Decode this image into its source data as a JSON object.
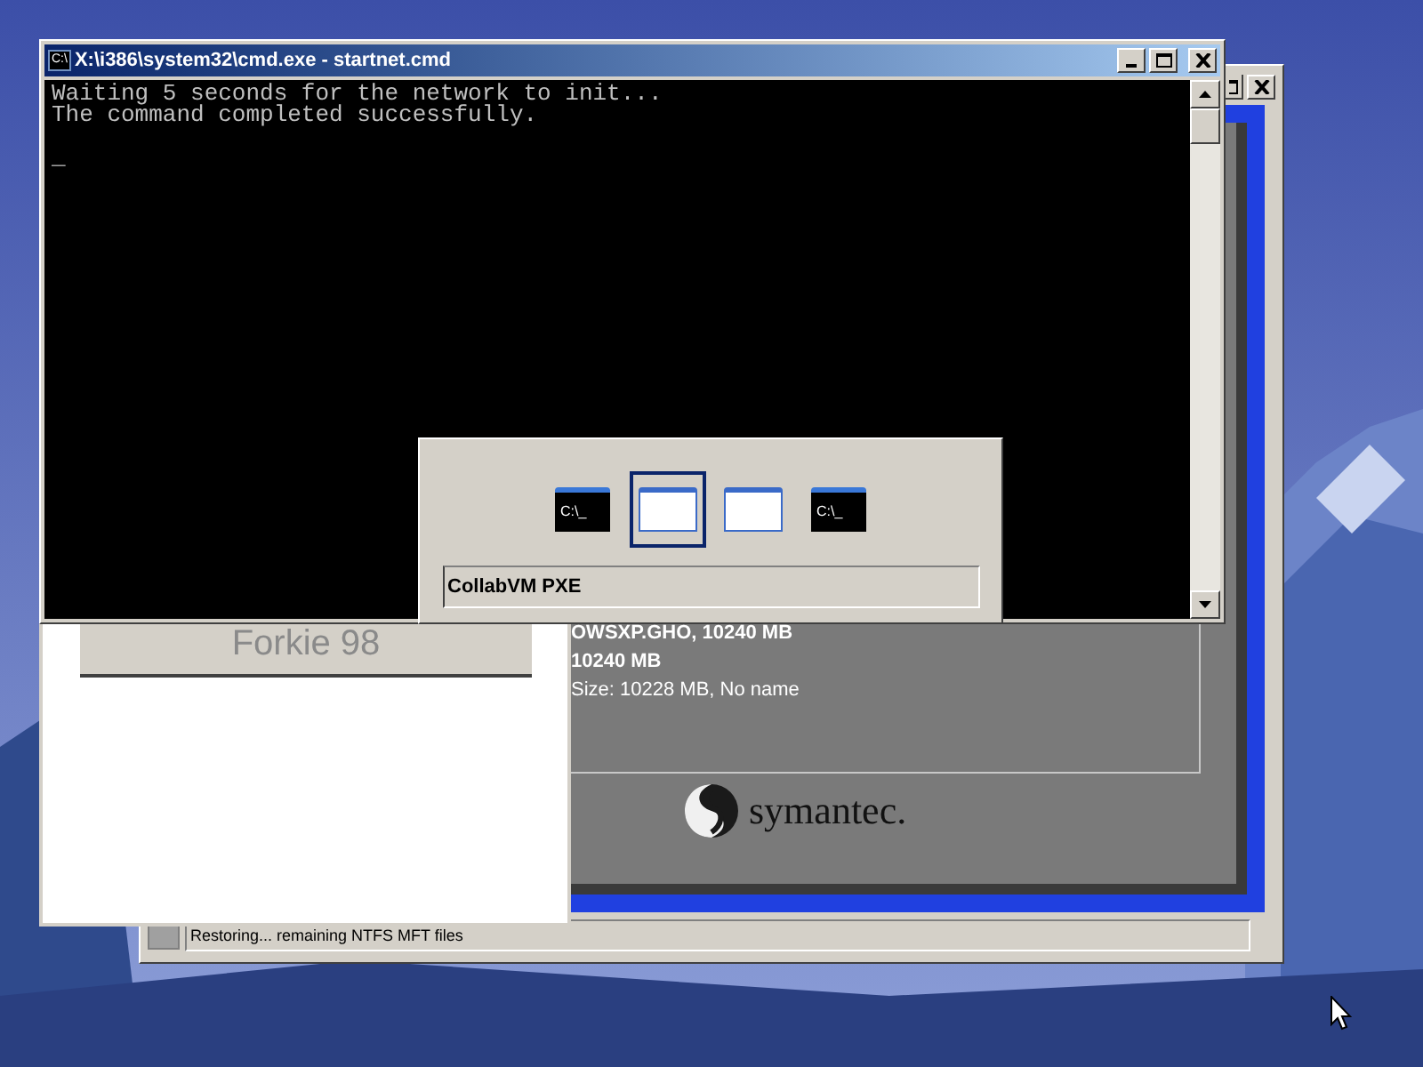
{
  "ghost_window": {
    "lines": [
      {
        "text": "OWSXP.GHO, 10240 MB",
        "bold": true
      },
      {
        "text": "10240 MB",
        "bold": true
      },
      {
        "text": "Size: 10228 MB, No name",
        "bold": false
      }
    ],
    "logo": "symantec.",
    "status": "Restoring... remaining NTFS MFT files"
  },
  "forkie_window": {
    "title": "Forkie 98"
  },
  "cmd_window": {
    "icon_text": "C:\\",
    "title": "X:\\i386\\system32\\cmd.exe - startnet.cmd",
    "lines": [
      "Waiting 5 seconds for the network to init...",
      "The command completed successfully."
    ],
    "cursor": "_"
  },
  "switcher": {
    "items": [
      {
        "kind": "console",
        "caption": "C:\\_",
        "selected": false
      },
      {
        "kind": "window",
        "selected": true
      },
      {
        "kind": "window",
        "selected": false
      },
      {
        "kind": "console",
        "caption": "C:\\_",
        "selected": false
      }
    ],
    "label": "CollabVM PXE"
  }
}
